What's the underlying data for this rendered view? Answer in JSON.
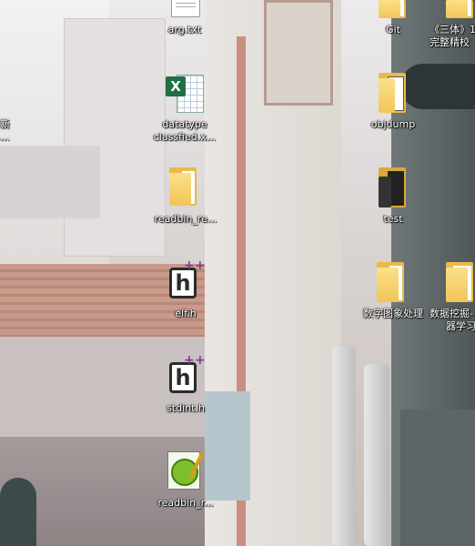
{
  "desktop": {
    "left_partial_label_line1": "新",
    "left_partial_label_line2": "...",
    "icons": [
      {
        "label": "arg.txt",
        "kind": "text-file"
      },
      {
        "label": "datatype classfied.x...",
        "line1": "datatype",
        "line2": "classfied.x...",
        "kind": "excel-file"
      },
      {
        "label": "readbin_re...",
        "kind": "folder"
      },
      {
        "label": "elf.h",
        "kind": "header-file"
      },
      {
        "label": "stdint.h",
        "kind": "header-file"
      },
      {
        "label": "readbin_r...",
        "kind": "notepad-file"
      },
      {
        "label": "Git",
        "kind": "folder"
      },
      {
        "label": "objdump",
        "kind": "folder"
      },
      {
        "label": "test",
        "kind": "folder"
      },
      {
        "label": "数字图象处理",
        "kind": "folder"
      },
      {
        "label": "《三体》完整精校",
        "line1": "《三体》1",
        "line2": "完整精校",
        "kind": "folder"
      },
      {
        "label": "数据挖掘与机器学习",
        "line1": "数据挖掘-",
        "line2": "器学习",
        "kind": "folder"
      }
    ]
  },
  "colors": {
    "folder_yellow": "#f2c557",
    "excel_green": "#1e7145",
    "header_plus": "#7b3c8f"
  }
}
